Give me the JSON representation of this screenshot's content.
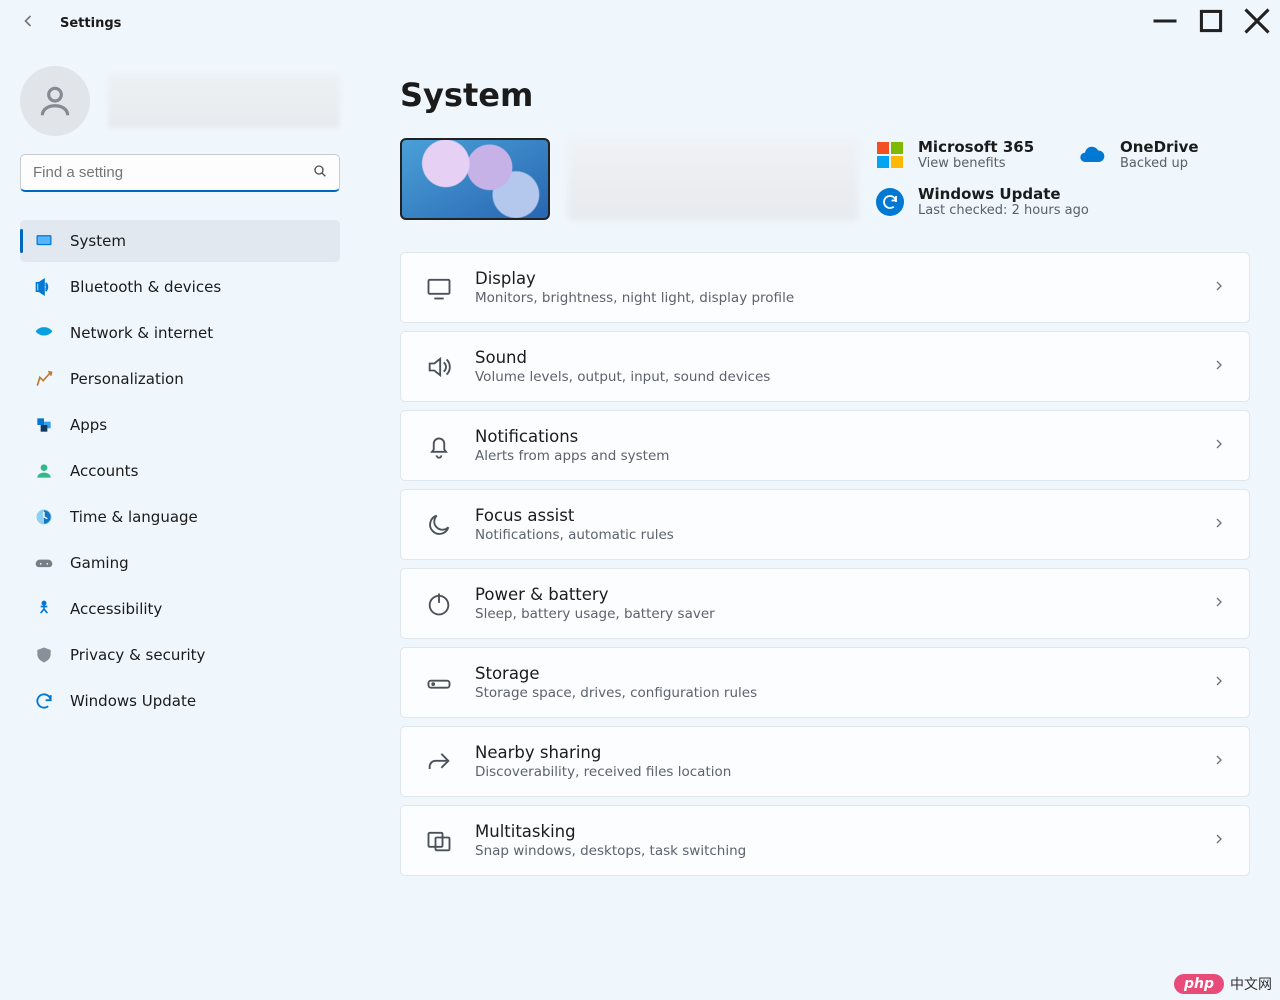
{
  "app": {
    "title": "Settings"
  },
  "page": {
    "title": "System"
  },
  "search": {
    "placeholder": "Find a setting"
  },
  "nav": {
    "items": [
      {
        "label": "System"
      },
      {
        "label": "Bluetooth & devices"
      },
      {
        "label": "Network & internet"
      },
      {
        "label": "Personalization"
      },
      {
        "label": "Apps"
      },
      {
        "label": "Accounts"
      },
      {
        "label": "Time & language"
      },
      {
        "label": "Gaming"
      },
      {
        "label": "Accessibility"
      },
      {
        "label": "Privacy & security"
      },
      {
        "label": "Windows Update"
      }
    ],
    "selected_index": 0
  },
  "quick": {
    "m365": {
      "title": "Microsoft 365",
      "subtitle": "View benefits"
    },
    "onedrive": {
      "title": "OneDrive",
      "subtitle": "Backed up"
    },
    "wu": {
      "title": "Windows Update",
      "subtitle": "Last checked: 2 hours ago"
    }
  },
  "cards": [
    {
      "icon": "display",
      "title": "Display",
      "subtitle": "Monitors, brightness, night light, display profile"
    },
    {
      "icon": "sound",
      "title": "Sound",
      "subtitle": "Volume levels, output, input, sound devices"
    },
    {
      "icon": "bell",
      "title": "Notifications",
      "subtitle": "Alerts from apps and system"
    },
    {
      "icon": "moon",
      "title": "Focus assist",
      "subtitle": "Notifications, automatic rules"
    },
    {
      "icon": "power",
      "title": "Power & battery",
      "subtitle": "Sleep, battery usage, battery saver"
    },
    {
      "icon": "storage",
      "title": "Storage",
      "subtitle": "Storage space, drives, configuration rules"
    },
    {
      "icon": "share",
      "title": "Nearby sharing",
      "subtitle": "Discoverability, received files location"
    },
    {
      "icon": "multitask",
      "title": "Multitasking",
      "subtitle": "Snap windows, desktops, task switching"
    }
  ],
  "watermark": {
    "brand": "php",
    "text": "中文网"
  }
}
